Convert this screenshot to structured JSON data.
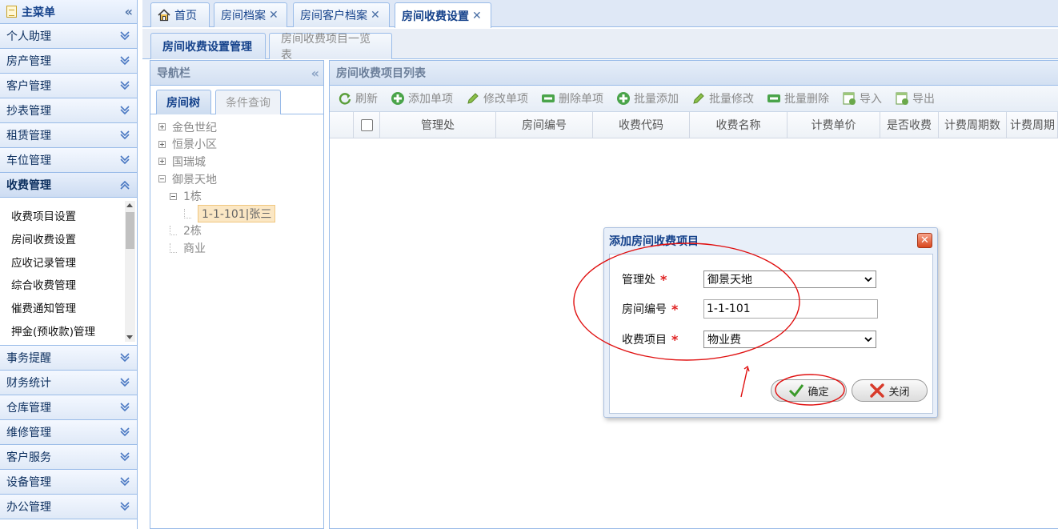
{
  "menu": {
    "title": "主菜单",
    "groups_top": [
      "个人助理",
      "房产管理",
      "客户管理",
      "抄表管理",
      "租赁管理",
      "车位管理"
    ],
    "active_group": "收费管理",
    "sub_items": [
      "收费项目设置",
      "房间收费设置",
      "应收记录管理",
      "综合收费管理",
      "催费通知管理",
      "押金(预收款)管理"
    ],
    "groups_bottom": [
      "事务提醒",
      "财务统计",
      "仓库管理",
      "维修管理",
      "客户服务",
      "设备管理",
      "办公管理"
    ]
  },
  "tabs": [
    {
      "label": "首页",
      "icon": "home-icon"
    },
    {
      "label": "房间档案",
      "close": "✕"
    },
    {
      "label": "房间客户档案",
      "close": "✕"
    },
    {
      "label": "房间收费设置",
      "close": "✕"
    }
  ],
  "inner_tabs": [
    "房间收费设置管理",
    "房间收费项目一览表"
  ],
  "nav": {
    "title": "导航栏",
    "tabs": [
      "房间树",
      "条件查询"
    ],
    "tree": {
      "n1": "金色世纪",
      "n2": "恒景小区",
      "n3": "国瑞城",
      "n4": "御景天地",
      "n4a": "1栋",
      "n4a1": "1-1-101|张三",
      "n4b": "2栋",
      "n4c": "商业"
    }
  },
  "grid": {
    "title": "房间收费项目列表",
    "toolbar": [
      "刷新",
      "添加单项",
      "修改单项",
      "删除单项",
      "批量添加",
      "批量修改",
      "批量删除",
      "导入",
      "导出"
    ],
    "columns": [
      "管理处",
      "房间编号",
      "收费代码",
      "收费名称",
      "计费单价",
      "是否收费",
      "计费周期数",
      "计费周期"
    ]
  },
  "dialog": {
    "title": "添加房间收费项目",
    "close": "✕",
    "fields": [
      {
        "label": "管理处",
        "value": "御景天地",
        "required": "*"
      },
      {
        "label": "房间编号",
        "value": "1-1-101",
        "required": "*"
      },
      {
        "label": "收费项目",
        "value": "物业费",
        "required": "*"
      }
    ],
    "ok_label": "确定",
    "cancel_label": "关闭"
  },
  "colors": {
    "border": "#99bbe8",
    "heading": "#15428b",
    "annotation": "#e01010"
  }
}
